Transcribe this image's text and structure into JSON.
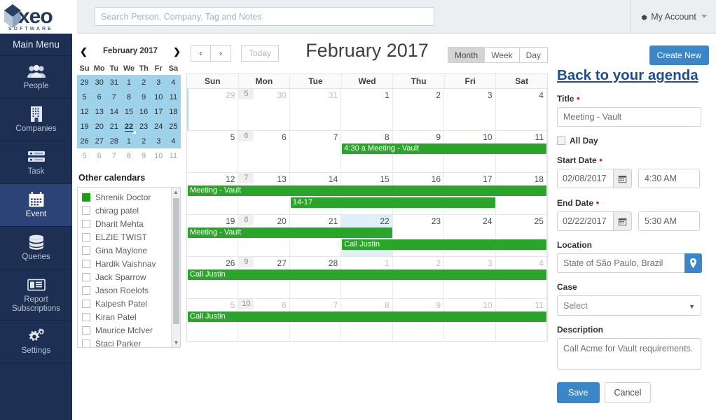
{
  "brand": {
    "name": "Xeo",
    "subtitle": "S O F T W A R E",
    "accent": "#1d3054",
    "blue": "#3b86c8",
    "green": "#2aa52a"
  },
  "topbar": {
    "search_placeholder": "Search Person, Company, Tag and Notes",
    "search_value": "",
    "account_label": "My Account",
    "gear_icon": "gear-icon",
    "caret_icon": "chevron-down-icon"
  },
  "sidebar": {
    "header": "Main Menu",
    "items": [
      {
        "label": "People",
        "icon": "people-icon",
        "active": false
      },
      {
        "label": "Companies",
        "icon": "building-icon",
        "active": false
      },
      {
        "label": "Task",
        "icon": "task-list-icon",
        "active": false
      },
      {
        "label": "Event",
        "icon": "calendar-icon",
        "active": true
      },
      {
        "label": "Queries",
        "icon": "database-icon",
        "active": false
      },
      {
        "label": "Report Subscriptions",
        "icon": "report-icon",
        "active": false
      },
      {
        "label": "Settings",
        "icon": "gears-icon",
        "active": false
      }
    ]
  },
  "minicalendar": {
    "title": "February 2017",
    "prev_icon": "chevron-left-icon",
    "next_icon": "chevron-right-icon",
    "dow": [
      "Su",
      "Mo",
      "Tu",
      "We",
      "Th",
      "Fr",
      "Sa"
    ],
    "weeks": [
      {
        "highlight": true,
        "days": [
          {
            "n": "29",
            "muted": false
          },
          {
            "n": "30",
            "muted": false
          },
          {
            "n": "31",
            "muted": false
          },
          {
            "n": "1",
            "muted": false
          },
          {
            "n": "2",
            "muted": false
          },
          {
            "n": "3",
            "muted": false
          },
          {
            "n": "4",
            "muted": false
          }
        ]
      },
      {
        "highlight": true,
        "days": [
          {
            "n": "5",
            "muted": false
          },
          {
            "n": "6",
            "muted": false
          },
          {
            "n": "7",
            "muted": false
          },
          {
            "n": "8",
            "muted": false
          },
          {
            "n": "9",
            "muted": false
          },
          {
            "n": "10",
            "muted": false
          },
          {
            "n": "11",
            "muted": false
          }
        ]
      },
      {
        "highlight": true,
        "days": [
          {
            "n": "12",
            "muted": false
          },
          {
            "n": "13",
            "muted": false
          },
          {
            "n": "14",
            "muted": false
          },
          {
            "n": "15",
            "muted": false
          },
          {
            "n": "16",
            "muted": false
          },
          {
            "n": "17",
            "muted": false
          },
          {
            "n": "18",
            "muted": false
          }
        ]
      },
      {
        "highlight": true,
        "days": [
          {
            "n": "19",
            "muted": false
          },
          {
            "n": "20",
            "muted": false
          },
          {
            "n": "21",
            "muted": false
          },
          {
            "n": "22",
            "muted": false,
            "today": true
          },
          {
            "n": "23",
            "muted": false
          },
          {
            "n": "24",
            "muted": false
          },
          {
            "n": "25",
            "muted": false
          }
        ]
      },
      {
        "highlight": true,
        "days": [
          {
            "n": "26",
            "muted": false
          },
          {
            "n": "27",
            "muted": false
          },
          {
            "n": "28",
            "muted": false
          },
          {
            "n": "1",
            "muted": false
          },
          {
            "n": "2",
            "muted": false
          },
          {
            "n": "3",
            "muted": false
          },
          {
            "n": "4",
            "muted": false
          }
        ]
      },
      {
        "highlight": false,
        "days": [
          {
            "n": "5",
            "muted": true
          },
          {
            "n": "6",
            "muted": true
          },
          {
            "n": "7",
            "muted": true
          },
          {
            "n": "8",
            "muted": true
          },
          {
            "n": "9",
            "muted": true
          },
          {
            "n": "10",
            "muted": true
          },
          {
            "n": "11",
            "muted": true
          }
        ]
      }
    ]
  },
  "othercalendars": {
    "title": "Other calendars",
    "items": [
      {
        "name": "Shrenik Doctor",
        "checked": true,
        "color": "#16a016"
      },
      {
        "name": "chirag patel",
        "checked": false
      },
      {
        "name": "Dharit Mehta",
        "checked": false
      },
      {
        "name": "ELZIE TWIST",
        "checked": false
      },
      {
        "name": "Gina Maylone",
        "checked": false
      },
      {
        "name": "Hardik Vaishnav",
        "checked": false
      },
      {
        "name": "Jack Sparrow",
        "checked": false
      },
      {
        "name": "Jason Roelofs",
        "checked": false
      },
      {
        "name": "Kalpesh Patel",
        "checked": false
      },
      {
        "name": "Kiran Patel",
        "checked": false
      },
      {
        "name": "Maurice McIver",
        "checked": false
      },
      {
        "name": "Staci Parker",
        "checked": false
      }
    ]
  },
  "calendar": {
    "title": "February 2017",
    "prev_label": "‹",
    "next_label": "›",
    "today_label": "Today",
    "views": [
      {
        "label": "Month",
        "selected": true
      },
      {
        "label": "Week",
        "selected": false
      },
      {
        "label": "Day",
        "selected": false
      }
    ],
    "dow": [
      "Sun",
      "Mon",
      "Tue",
      "Wed",
      "Thu",
      "Fri",
      "Sat"
    ],
    "weeks": [
      {
        "weeknum": "5",
        "days": [
          {
            "n": "29",
            "muted": true
          },
          {
            "n": "30",
            "muted": true
          },
          {
            "n": "31",
            "muted": true
          },
          {
            "n": "1",
            "muted": false
          },
          {
            "n": "2",
            "muted": false
          },
          {
            "n": "3",
            "muted": false
          },
          {
            "n": "4",
            "muted": false
          }
        ],
        "events": []
      },
      {
        "weeknum": "6",
        "days": [
          {
            "n": "5",
            "muted": false
          },
          {
            "n": "6",
            "muted": false
          },
          {
            "n": "7",
            "muted": false
          },
          {
            "n": "8",
            "muted": false
          },
          {
            "n": "9",
            "muted": false
          },
          {
            "n": "10",
            "muted": false
          },
          {
            "n": "11",
            "muted": false
          }
        ],
        "events": [
          {
            "label": "4:30 a Meeting - Vault",
            "start": 3,
            "span": 4,
            "row": 0
          }
        ]
      },
      {
        "weeknum": "7",
        "days": [
          {
            "n": "12",
            "muted": false
          },
          {
            "n": "13",
            "muted": false
          },
          {
            "n": "14",
            "muted": false
          },
          {
            "n": "15",
            "muted": false
          },
          {
            "n": "16",
            "muted": false
          },
          {
            "n": "17",
            "muted": false
          },
          {
            "n": "18",
            "muted": false
          }
        ],
        "events": [
          {
            "label": "Meeting - Vault",
            "start": 0,
            "span": 7,
            "row": 0
          },
          {
            "label": "14-17",
            "start": 2,
            "span": 4,
            "row": 1
          }
        ]
      },
      {
        "weeknum": "8",
        "days": [
          {
            "n": "19",
            "muted": false
          },
          {
            "n": "20",
            "muted": false
          },
          {
            "n": "21",
            "muted": false
          },
          {
            "n": "22",
            "muted": false,
            "highlight": true
          },
          {
            "n": "23",
            "muted": false
          },
          {
            "n": "24",
            "muted": false
          },
          {
            "n": "25",
            "muted": false
          }
        ],
        "events": [
          {
            "label": "Meeting - Vault",
            "start": 0,
            "span": 4,
            "row": 0
          },
          {
            "label": "Call Justin",
            "start": 3,
            "span": 4,
            "row": 1
          }
        ]
      },
      {
        "weeknum": "9",
        "days": [
          {
            "n": "26",
            "muted": false
          },
          {
            "n": "27",
            "muted": false
          },
          {
            "n": "28",
            "muted": false
          },
          {
            "n": "1",
            "muted": true
          },
          {
            "n": "2",
            "muted": true
          },
          {
            "n": "3",
            "muted": true
          },
          {
            "n": "4",
            "muted": true
          }
        ],
        "events": [
          {
            "label": "Call Justin",
            "start": 0,
            "span": 7,
            "row": 0
          }
        ]
      },
      {
        "weeknum": "10",
        "days": [
          {
            "n": "5",
            "muted": true
          },
          {
            "n": "6",
            "muted": true
          },
          {
            "n": "7",
            "muted": true
          },
          {
            "n": "8",
            "muted": true
          },
          {
            "n": "9",
            "muted": true
          },
          {
            "n": "10",
            "muted": true
          },
          {
            "n": "11",
            "muted": true
          }
        ],
        "events": [
          {
            "label": "Call Justin",
            "start": 0,
            "span": 7,
            "row": 0
          }
        ]
      }
    ]
  },
  "form": {
    "create_new_label": "Create New",
    "back_link": "Back to your agenda",
    "title_label": "Title",
    "title_value": "Meeting - Vault",
    "allday_label": "All Day",
    "allday_checked": false,
    "start_label": "Start Date",
    "start_date": "02/08/2017",
    "start_time": "4:30 AM",
    "end_label": "End Date",
    "end_date": "02/22/2017",
    "end_time": "5:30 AM",
    "location_label": "Location",
    "location_value": "State of São Paulo, Brazil",
    "location_icon": "map-pin-icon",
    "case_label": "Case",
    "case_value": "Select",
    "description_label": "Description",
    "description_value": "Call Acme for Vault requirements.",
    "save_label": "Save",
    "cancel_label": "Cancel",
    "calendar_icon": "calendar-icon"
  }
}
